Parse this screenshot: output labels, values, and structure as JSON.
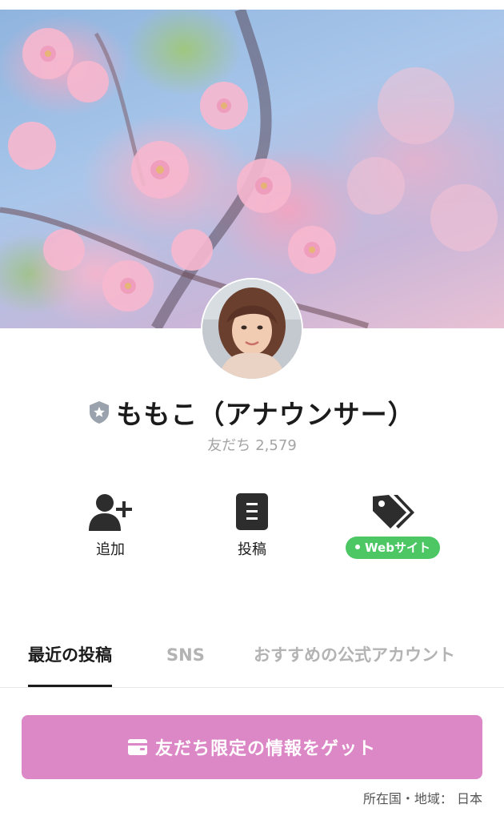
{
  "profile": {
    "name": "ももこ（アナウンサー）",
    "friends_label": "友だち",
    "friends_count": "2,579"
  },
  "actions": {
    "add_label": "追加",
    "posts_label": "投稿",
    "website_label": "Webサイト"
  },
  "tabs": [
    "最近の投稿",
    "SNS",
    "おすすめの公式アカウント"
  ],
  "cta": {
    "label": "友だち限定の情報をゲット"
  },
  "footer": {
    "location": "所在国・地域： 日本"
  },
  "colors": {
    "cta_bg": "#dd88c6",
    "badge_green": "#4cc764",
    "text": "#1b1b1b",
    "muted": "#a4a4a4"
  },
  "icons": [
    "shield-star-icon",
    "add-friend-icon",
    "posts-icon",
    "tag-icon",
    "wallet-icon"
  ]
}
